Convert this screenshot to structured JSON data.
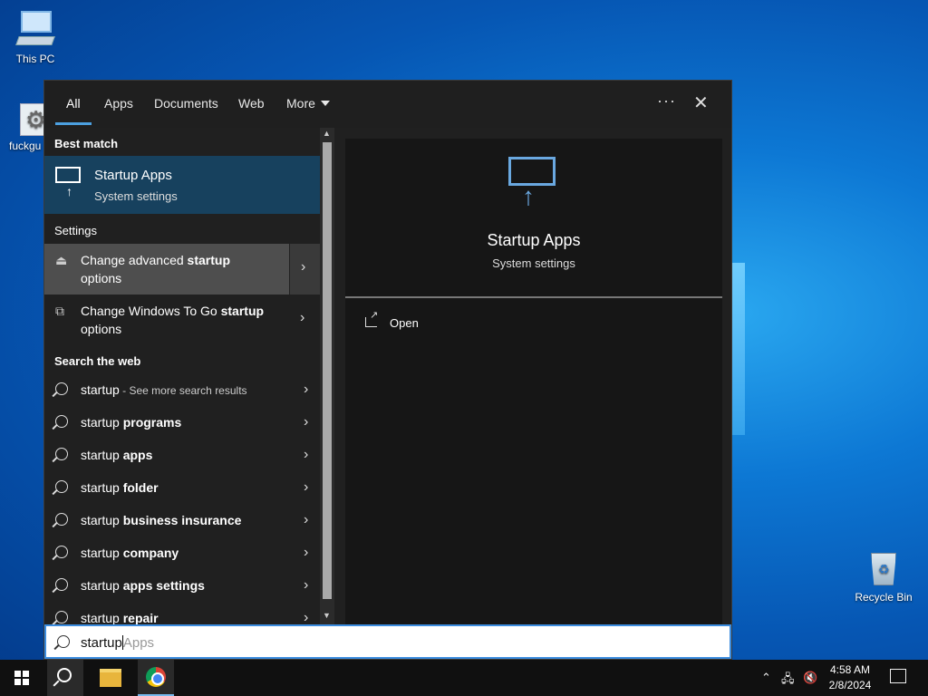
{
  "desktop": {
    "icons": [
      {
        "label": "This PC"
      },
      {
        "label": "fuckgu"
      },
      {
        "label": "Recycle Bin"
      }
    ]
  },
  "search": {
    "tabs": [
      {
        "label": "All",
        "active": true
      },
      {
        "label": "Apps"
      },
      {
        "label": "Documents"
      },
      {
        "label": "Web"
      },
      {
        "label": "More"
      }
    ],
    "more_icon": "ellipsis-icon",
    "close_icon": "close-icon",
    "best_match_header": "Best match",
    "best_match": {
      "title": "Startup Apps",
      "subtitle": "System settings"
    },
    "settings_header": "Settings",
    "settings_items": [
      {
        "text_plain": "Change advanced ",
        "text_bold": "startup",
        "text_tail": "options"
      },
      {
        "text_plain": "Change Windows To Go ",
        "text_bold": "startup",
        "text_tail": "options"
      }
    ],
    "web_header": "Search the web",
    "web_items": [
      {
        "plain": "startup",
        "bold": "",
        "sub": " - See more search results"
      },
      {
        "plain": "startup ",
        "bold": "programs",
        "sub": ""
      },
      {
        "plain": "startup ",
        "bold": "apps",
        "sub": ""
      },
      {
        "plain": "startup ",
        "bold": "folder",
        "sub": ""
      },
      {
        "plain": "startup ",
        "bold": "business insurance",
        "sub": ""
      },
      {
        "plain": "startup ",
        "bold": "company",
        "sub": ""
      },
      {
        "plain": "startup ",
        "bold": "apps settings",
        "sub": ""
      },
      {
        "plain": "startup ",
        "bold": "repair",
        "sub": ""
      }
    ],
    "preview": {
      "title": "Startup Apps",
      "subtitle": "System settings",
      "open_label": "Open"
    },
    "query": "startup",
    "suggestion": "Apps"
  },
  "taskbar": {
    "clock_time": "4:58 AM",
    "clock_date": "2/8/2024"
  }
}
